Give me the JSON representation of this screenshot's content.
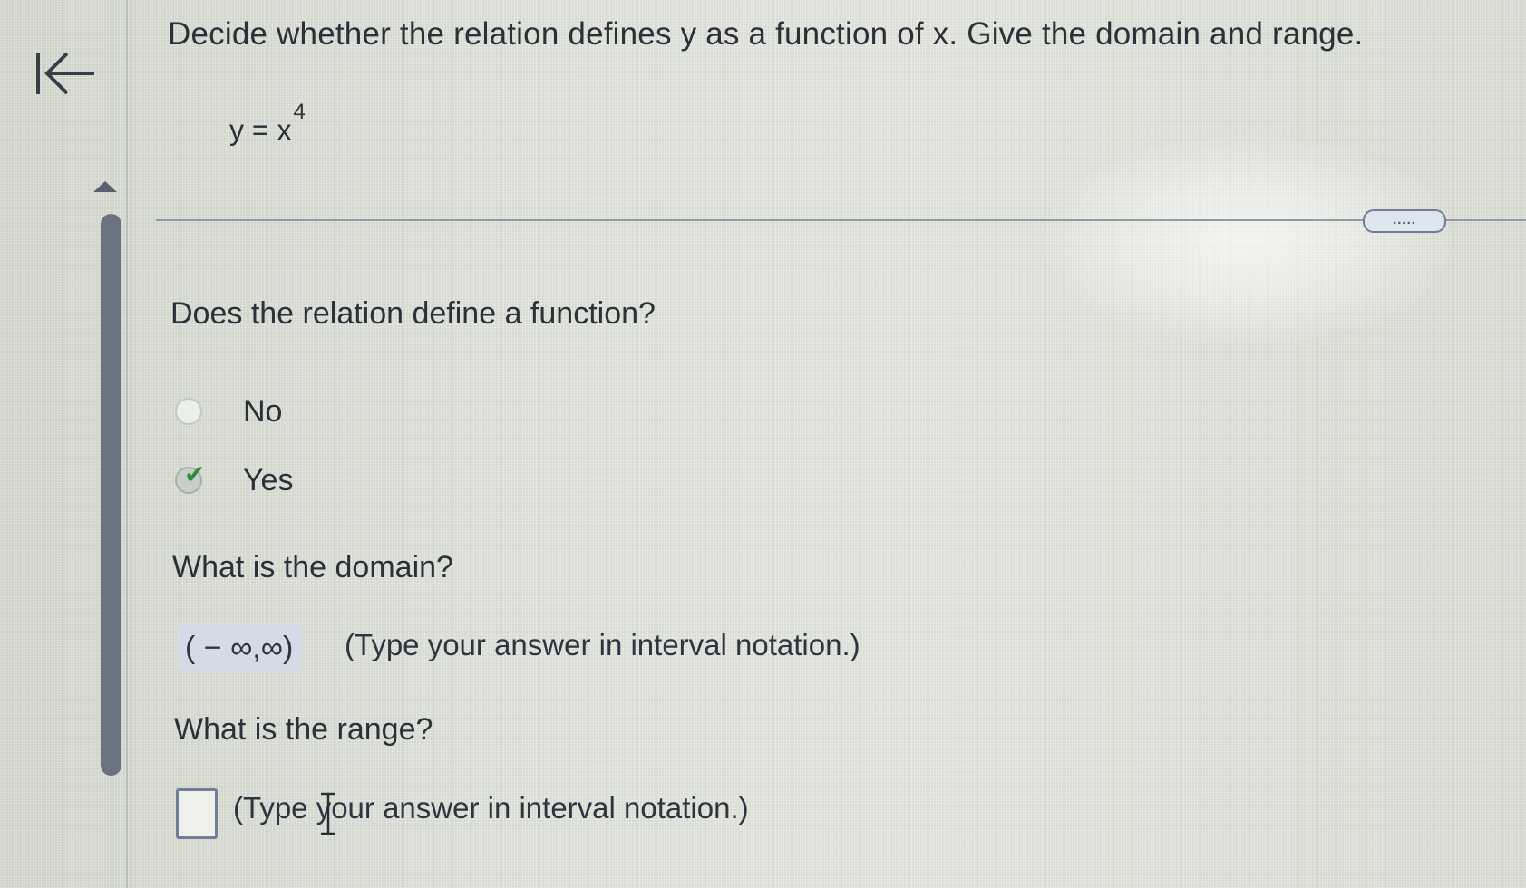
{
  "nav": {
    "back_icon": "first-page-icon"
  },
  "question": {
    "text": "Decide whether the relation defines y as a function of x. Give the domain and range.",
    "equation_base": "y = x",
    "equation_exponent": "4"
  },
  "more_button": {
    "label": "....."
  },
  "function_part": {
    "prompt": "Does the relation define a function?",
    "options": [
      {
        "label": "No",
        "selected": false
      },
      {
        "label": "Yes",
        "selected": true
      }
    ]
  },
  "domain_part": {
    "prompt": "What is the domain?",
    "answer": "( − ∞,∞)",
    "hint": "(Type your answer in interval notation.)"
  },
  "range_part": {
    "prompt": "What is the range?",
    "answer": "",
    "hint": "(Type your answer in interval notation.)"
  },
  "colors": {
    "accent_check": "#2e8a3e",
    "answer_highlight": "#d3dce6",
    "input_border": "#6f7f98"
  }
}
